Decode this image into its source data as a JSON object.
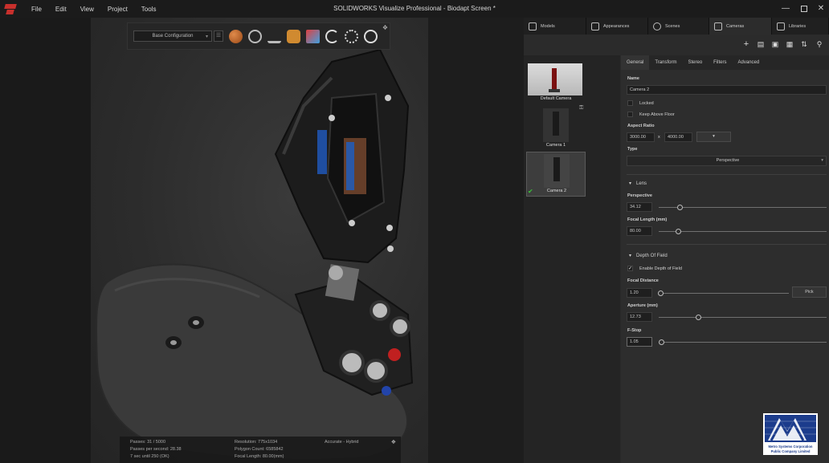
{
  "app": {
    "window_title": "SOLIDWORKS Visualize Professional - Biodapt Screen *",
    "menu": [
      "File",
      "Edit",
      "View",
      "Project",
      "Tools"
    ]
  },
  "viewport": {
    "configuration": "Base Configuration",
    "status": {
      "passes": "Passes: 31 / 5000",
      "passes_per_second": "Passes per second: 28.38",
      "time_until": "7 sec until 250 (OK)",
      "resolution": "Resolution: 775x1034",
      "polygon_count": "Polygon Count: 6585842",
      "focal_length": "Focal Length: 80.00(mm)",
      "mode": "Accurate - Hybrid"
    }
  },
  "palette": {
    "tabs": [
      {
        "label": "Models",
        "icon": "cube-icon"
      },
      {
        "label": "Appearances",
        "icon": "paint-can-icon"
      },
      {
        "label": "Scenes",
        "icon": "globe-icon"
      },
      {
        "label": "Cameras",
        "icon": "camera-icon"
      },
      {
        "label": "Libraries",
        "icon": "books-icon"
      }
    ],
    "cameras": [
      {
        "label": "Default Camera",
        "locked": true
      },
      {
        "label": "Camera 1",
        "locked": false
      },
      {
        "label": "Camera 2",
        "locked": false,
        "selected": true
      }
    ]
  },
  "props": {
    "tabs": [
      "General",
      "Transform",
      "Stereo",
      "Filters",
      "Advanced"
    ],
    "name_label": "Name",
    "name_value": "Camera 2",
    "locked_label": "Locked",
    "keep_above_floor_label": "Keep Above Floor",
    "aspect_ratio_label": "Aspect Ratio",
    "aspect_w": "3000.00",
    "aspect_x": "x",
    "aspect_h": "4000.00",
    "type_label": "Type",
    "type_value": "Perspective",
    "lens_header": "Lens",
    "perspective_label": "Perspective",
    "perspective_value": "34.12",
    "perspective_fraction": 0.13,
    "focal_length_label": "Focal Length (mm)",
    "focal_length_value": "80.00",
    "focal_length_fraction": 0.12,
    "dof_header": "Depth Of Field",
    "enable_dof_label": "Enable Depth of Field",
    "enable_dof_checked": true,
    "focal_distance_label": "Focal Distance",
    "focal_distance_value": "1.20",
    "focal_distance_fraction": 0.02,
    "pick_button": "Pick",
    "aperture_label": "Aperture (mm)",
    "aperture_value": "12.73",
    "aperture_fraction": 0.24,
    "fstop_label": "F-Stop",
    "fstop_value": "1.05",
    "fstop_fraction": 0.02
  },
  "brand": {
    "line1": "Metro Systems Corporation",
    "line2": "Public Company Limited"
  }
}
